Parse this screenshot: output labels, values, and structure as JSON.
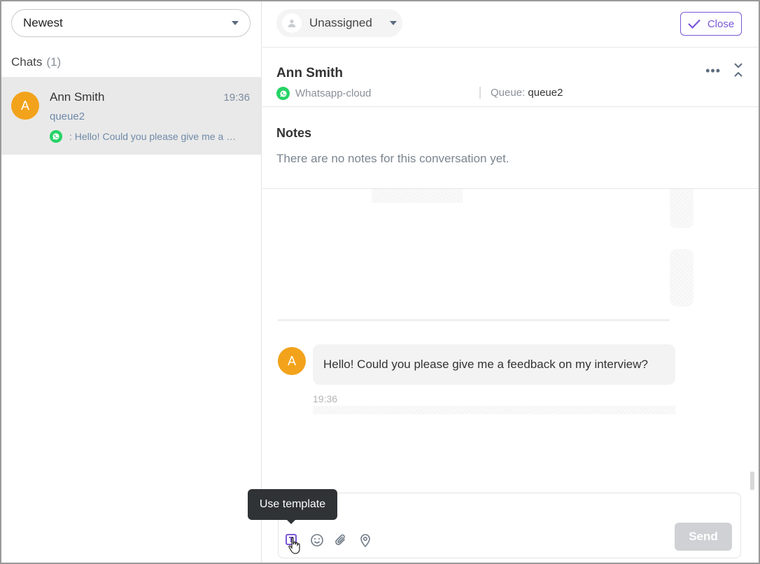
{
  "sidebar": {
    "sort": {
      "selected": "Newest"
    },
    "chats_label": "Chats",
    "chats_count": "(1)",
    "chats": [
      {
        "avatar_initial": "A",
        "name": "Ann Smith",
        "time": "19:36",
        "queue": "queue2",
        "preview": ": Hello! Could you please give me a feedback on my interview?"
      }
    ]
  },
  "header": {
    "assignee": "Unassigned",
    "close_label": "Close"
  },
  "contact": {
    "name": "Ann Smith",
    "channel": "Whatsapp-cloud",
    "queue_label": "Queue:",
    "queue_value": "queue2"
  },
  "notes": {
    "title": "Notes",
    "empty_text": "There are no notes for this conversation yet."
  },
  "messages": [
    {
      "avatar_initial": "A",
      "text": "Hello! Could you please give me a feedback on my interview?",
      "time": "19:36"
    }
  ],
  "composer": {
    "tooltip": "Use template",
    "send_label": "Send"
  },
  "colors": {
    "accent": "#7b56d8",
    "avatar": "#f2a31b",
    "whatsapp": "#25d366",
    "selected_row": "#e9e9e9",
    "send_disabled": "#cfd1d4",
    "tooltip_bg": "#2f3336"
  }
}
